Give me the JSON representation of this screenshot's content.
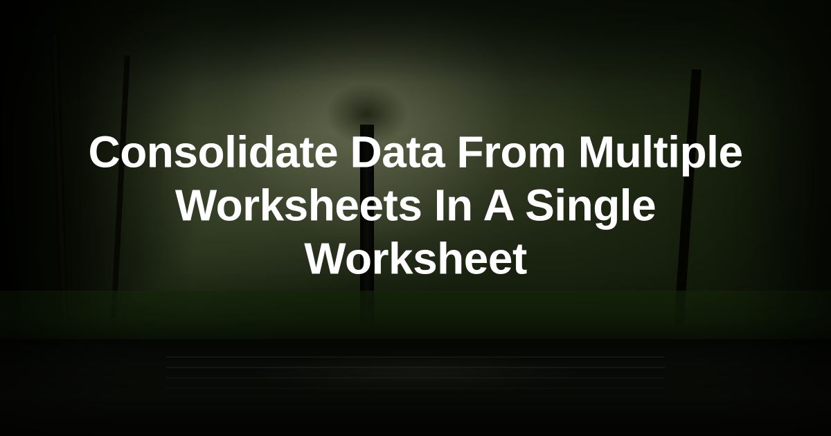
{
  "hero": {
    "title": "Consolidate Data From Multiple Worksheets In A Single Worksheet"
  }
}
